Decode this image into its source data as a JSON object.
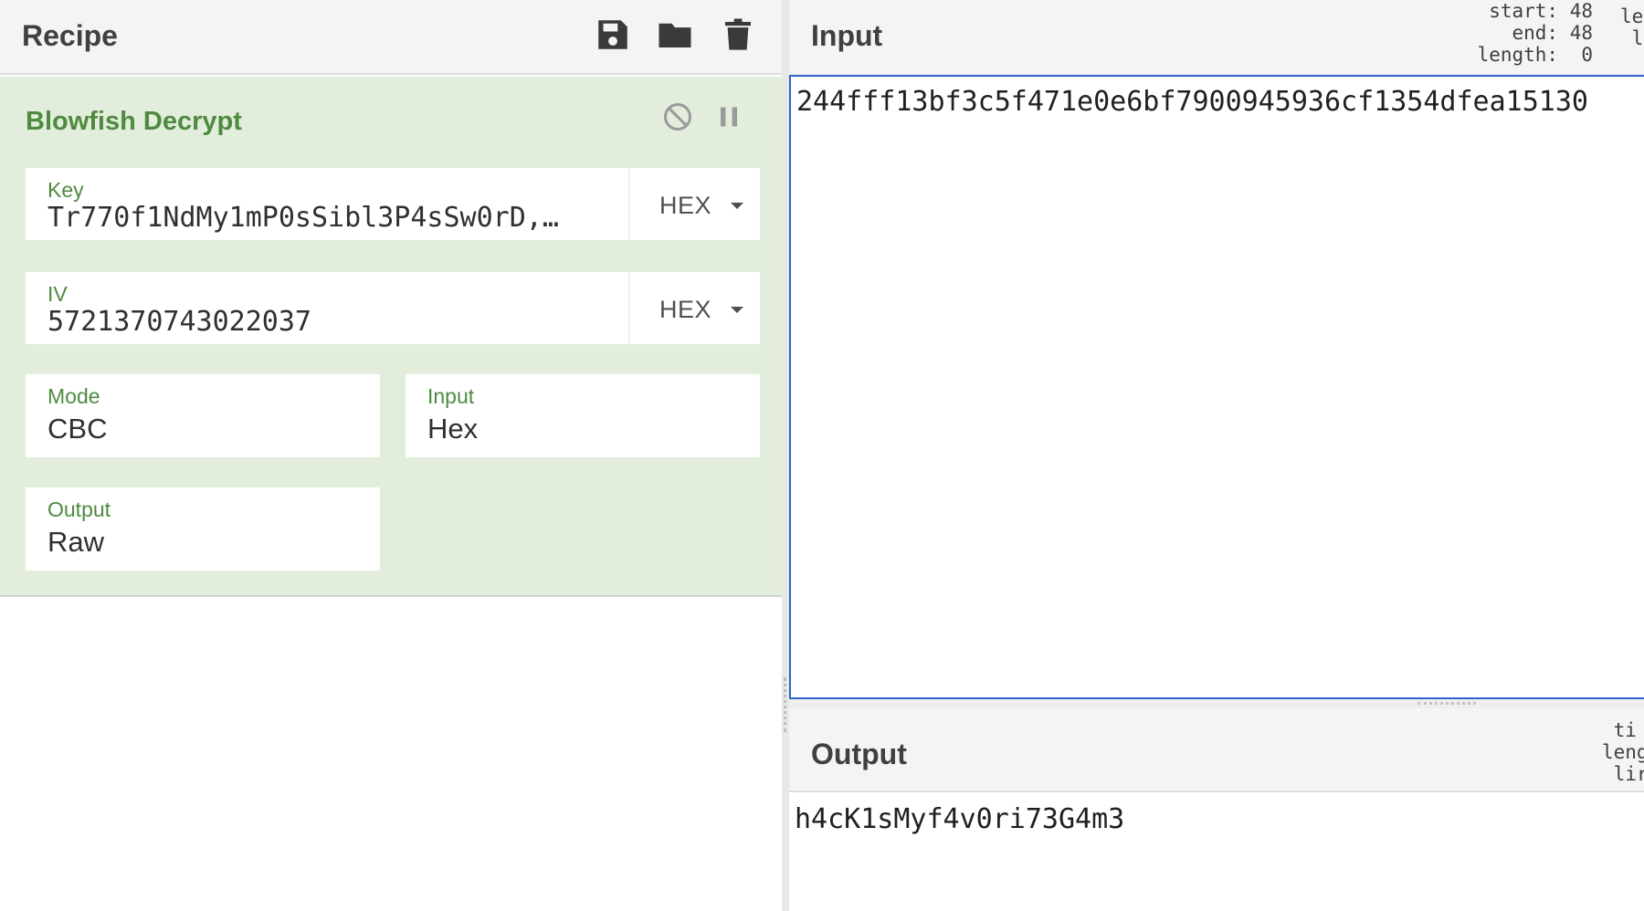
{
  "recipe": {
    "title": "Recipe",
    "icons": [
      "save-icon",
      "folder-icon",
      "trash-icon"
    ]
  },
  "operation": {
    "name": "Blowfish Decrypt",
    "icons": [
      "disable-icon",
      "pause-icon"
    ],
    "key": {
      "label": "Key",
      "value": "Tr770f1NdMy1mP0sSibl3P4sSw0rD,…",
      "format": "HEX"
    },
    "iv": {
      "label": "IV",
      "value": "5721370743022037",
      "format": "HEX"
    },
    "mode": {
      "label": "Mode",
      "value": "CBC"
    },
    "input": {
      "label": "Input",
      "value": "Hex"
    },
    "output": {
      "label": "Output",
      "value": "Raw"
    }
  },
  "input_pane": {
    "title": "Input",
    "info": "start: 48\n  end: 48\nlength:  0",
    "info_clipped": "le\n l",
    "text": "244fff13bf3c5f471e0e6bf7900945936cf1354dfea15130"
  },
  "output_pane": {
    "title": "Output",
    "info_clipped": " ti\nleng\n lir",
    "text": "h4cK1sMyf4v0ri73G4m3"
  },
  "colors": {
    "operation_bg": "#e2eedb",
    "operation_accent": "#4f8a40",
    "input_focus_border": "#2e64c8",
    "header_bg": "#f4f4f4"
  }
}
